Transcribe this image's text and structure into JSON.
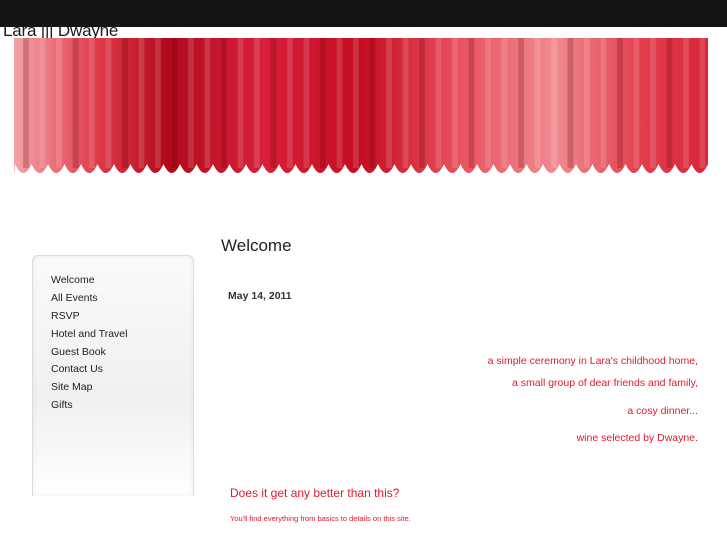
{
  "site": {
    "title": "Lara ||| Dwayne"
  },
  "nav": {
    "items": [
      "Welcome",
      "All Events",
      "RSVP",
      "Hotel and Travel",
      "Guest Book",
      "Contact Us",
      "Site Map",
      "Gifts"
    ]
  },
  "main": {
    "heading": "Welcome",
    "date": "May 14, 2011",
    "lines": [
      "a simple ceremony in Lara's childhood home,",
      "a small group of dear friends and family,",
      "a cosy dinner...",
      "wine selected by Dwayne."
    ],
    "tagline": "Does it get any better than this?",
    "subline": "You'll find everything from basics to details on this site."
  },
  "colors": {
    "accent": "#e0192c",
    "curtain_dark": "#9e0818",
    "curtain_light": "#f5a6ad",
    "page_bg": "#141414"
  }
}
